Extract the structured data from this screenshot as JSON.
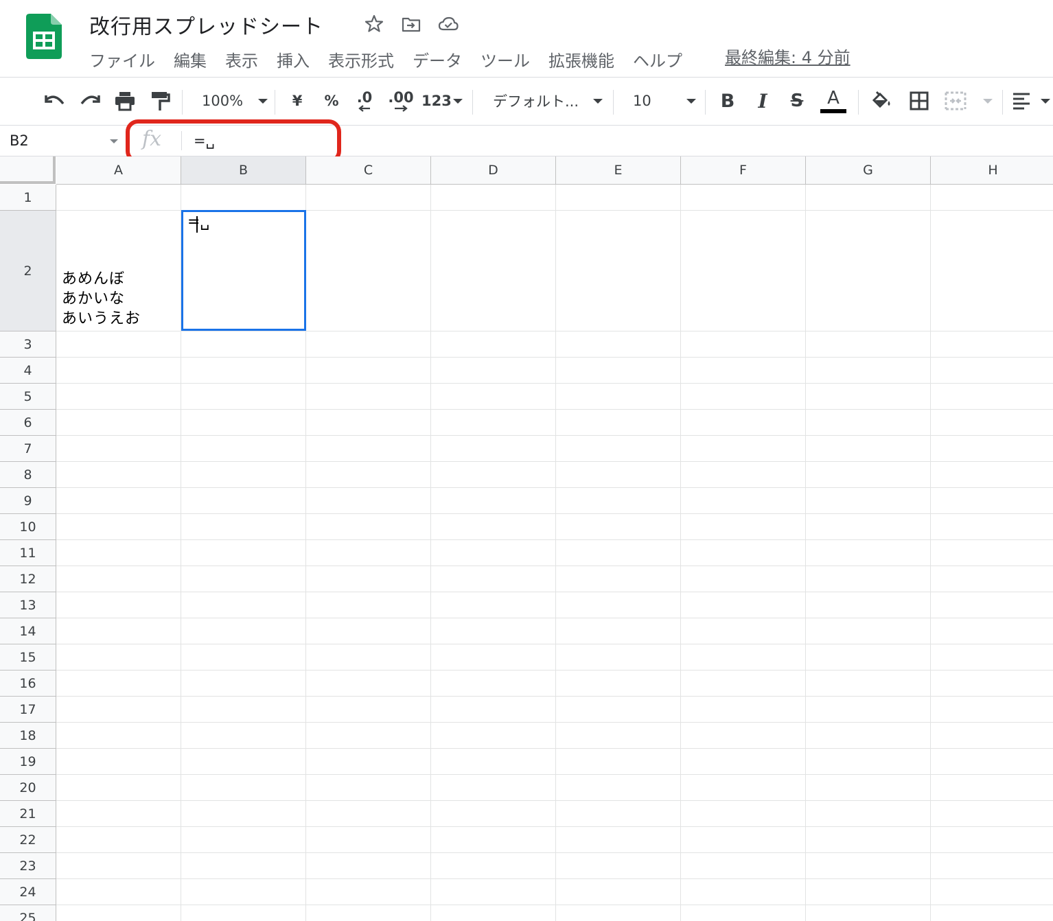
{
  "app": {
    "title": "改行用スプレッドシート",
    "brand_color": "#0f9d58"
  },
  "menu": {
    "items": [
      "ファイル",
      "編集",
      "表示",
      "挿入",
      "表示形式",
      "データ",
      "ツール",
      "拡張機能",
      "ヘルプ"
    ],
    "last_edit": "最終編集: 4 分前"
  },
  "toolbar": {
    "zoom": "100%",
    "currency": "¥",
    "percent": "%",
    "decimal_decrease": ".0",
    "decimal_increase": ".00",
    "more_formats": "123",
    "font": "デフォルト...",
    "font_size": "10",
    "bold": "B",
    "italic": "I",
    "strike": "S",
    "text_color": "A",
    "text_color_value": "#000000"
  },
  "formula_bar": {
    "name_box": "B2",
    "fx": "fx",
    "formula": "=␣"
  },
  "highlight_color": "#e0261c",
  "grid": {
    "columns": [
      "A",
      "B",
      "C",
      "D",
      "E",
      "F",
      "G",
      "H"
    ],
    "rows": [
      "1",
      "2",
      "3",
      "4",
      "5",
      "6",
      "7",
      "8",
      "9",
      "10",
      "11",
      "12",
      "13",
      "14",
      "15",
      "16",
      "17",
      "18",
      "19",
      "20",
      "21",
      "22",
      "23",
      "24",
      "25"
    ],
    "selected_cell": "B2",
    "selection_color": "#1a73e8",
    "cells": {
      "A2": "あめんぼ\nあかいな\nあいうえお",
      "B2": "=␣"
    }
  }
}
